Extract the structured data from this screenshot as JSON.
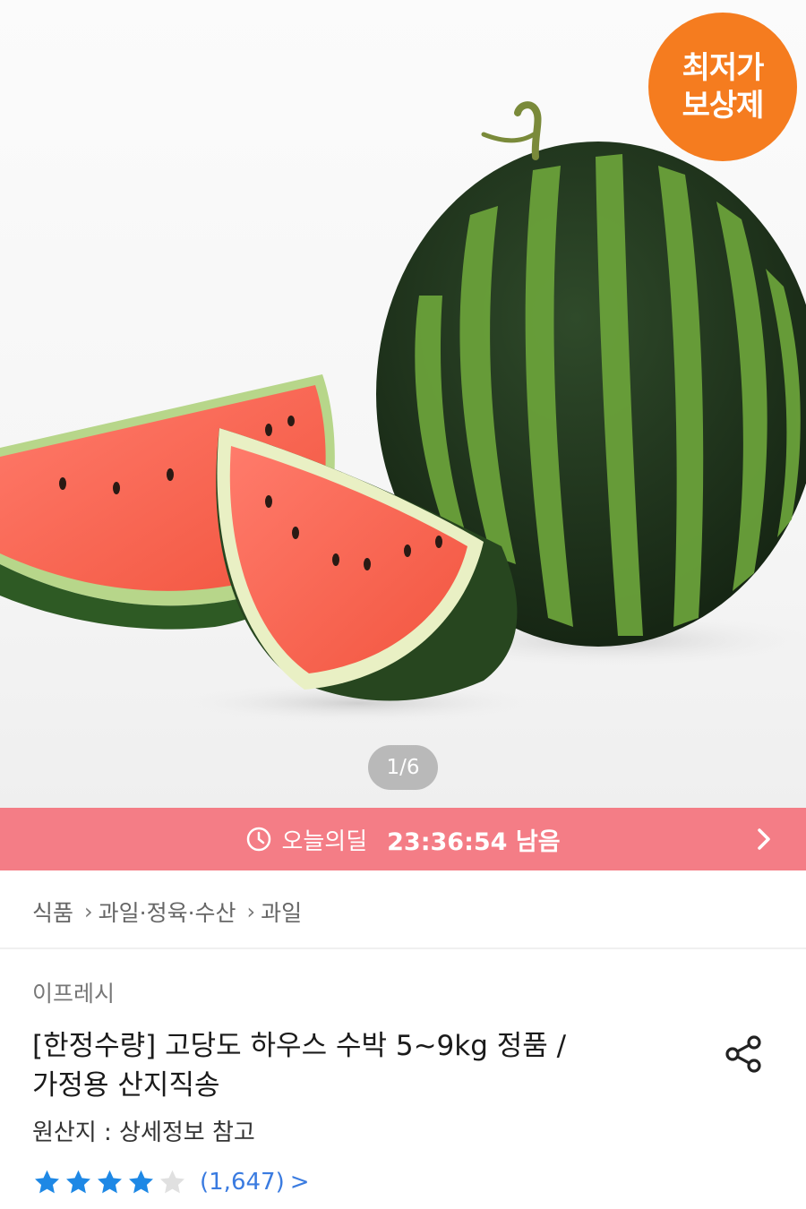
{
  "hero": {
    "badge_line1": "최저가",
    "badge_line2": "보상제",
    "pager": "1/6",
    "badge_color": "#f57c1f"
  },
  "deal_bar": {
    "icon": "clock-icon",
    "label": "오늘의딜",
    "timer": "23:36:54 남음",
    "arrow_icon": "chevron-right-icon",
    "color": "#f47d86"
  },
  "breadcrumb": {
    "items": [
      "식품",
      "과일·정육·수산",
      "과일"
    ]
  },
  "product": {
    "seller": "이프레시",
    "title_line1": "[한정수량] 고당도 하우스 수박 5~9kg 정품 /",
    "title_line2": "가정용 산지직송",
    "origin": "원산지 : 상세정보 참고",
    "share_icon": "share-icon"
  },
  "rating": {
    "stars": 4,
    "max_stars": 5,
    "count": "(1,647)",
    "chevron": ">",
    "star_color": "#1e88e5",
    "empty_star_color": "#e0e0e0"
  }
}
